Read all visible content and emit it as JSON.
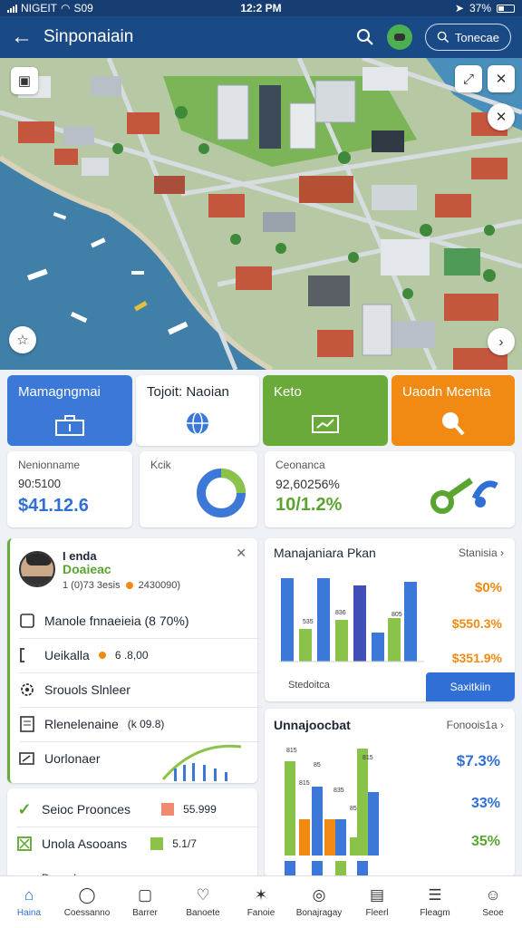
{
  "status_bar": {
    "carrier": "NIGEIT",
    "extra": "S09",
    "time": "12:2 PM",
    "battery": "37%"
  },
  "app_bar": {
    "title": "Sinponaiain",
    "action_label": "Tonecae"
  },
  "tiles": [
    {
      "label": "Mamagngmai",
      "color": "#3c78d8",
      "text_color": "#ffffff"
    },
    {
      "label": "Tojoit: Naoian",
      "color": "#ffffff",
      "text_color": "#1d2733"
    },
    {
      "label": "Keto",
      "color": "#6aaa3a",
      "text_color": "#ffffff"
    },
    {
      "label": "Uaodn Mcenta",
      "color": "#f08a12",
      "text_color": "#ffffff"
    }
  ],
  "stats": {
    "first": {
      "label": "Nenionname",
      "sub": "90:5100",
      "value": "$41.12.6"
    },
    "second": {
      "label": "Kcik"
    },
    "third": {
      "label": "Ceonanca",
      "sub": "92,60256%",
      "value": "10/1.2%"
    }
  },
  "profile": {
    "name": "I enda",
    "role": "Doaieac",
    "meta": "1 (0)73 3esis",
    "meta2": "2430090)"
  },
  "list_items": [
    {
      "label": "Manole fnnaeieia (8 70%)",
      "icon": "square-icon"
    },
    {
      "label": "Ueikalla",
      "value": "6 .8,00",
      "icon": "bracket-icon"
    },
    {
      "label": "Srouols Slnleer",
      "icon": "gear-icon"
    },
    {
      "label": "Rlenelenaine",
      "value": "(k 09.8)",
      "icon": "doc-icon"
    },
    {
      "label": "Uorlonaer",
      "icon": "edit-icon"
    }
  ],
  "checks": [
    {
      "label": "Seioc Proonces",
      "value": "55.999",
      "icon": "checkmark-icon",
      "swatch": "#ee8a6d"
    },
    {
      "label": "Unola Asooans",
      "value": "5.1/7",
      "icon": "checkbox-icon",
      "swatch": "#8bc34a"
    },
    {
      "label": "Duoanbegg"
    }
  ],
  "chart1": {
    "title": "Manajaniara Pkan",
    "link": "Stanisia",
    "legend_values": [
      "$0%",
      "$550.3%",
      "$351.9%"
    ],
    "bar_value_labels": [
      "535",
      "836",
      "805"
    ],
    "footer_label": "Stedoitca",
    "button_label": "Saxitkiin"
  },
  "chart2": {
    "title": "Unnajoocbat",
    "link": "Fonoois1a",
    "tick_labels": [
      "815",
      "85",
      "835",
      "815",
      "815",
      "85"
    ],
    "legend_values": [
      "$7.3%",
      "33%",
      "35%"
    ]
  },
  "bottom_nav": [
    {
      "label": "Haina",
      "icon": "home-icon"
    },
    {
      "label": "Coessanno",
      "icon": "chat-icon"
    },
    {
      "label": "Barrer",
      "icon": "bag-icon"
    },
    {
      "label": "Banoete",
      "icon": "bell-icon"
    },
    {
      "label": "Fanoie",
      "icon": "pin-icon"
    },
    {
      "label": "Bonajragay",
      "icon": "globe-icon"
    },
    {
      "label": "Fleerl",
      "icon": "doc-icon"
    },
    {
      "label": "Fleagm",
      "icon": "list-icon"
    },
    {
      "label": "Seoe",
      "icon": "profile-icon"
    }
  ]
}
